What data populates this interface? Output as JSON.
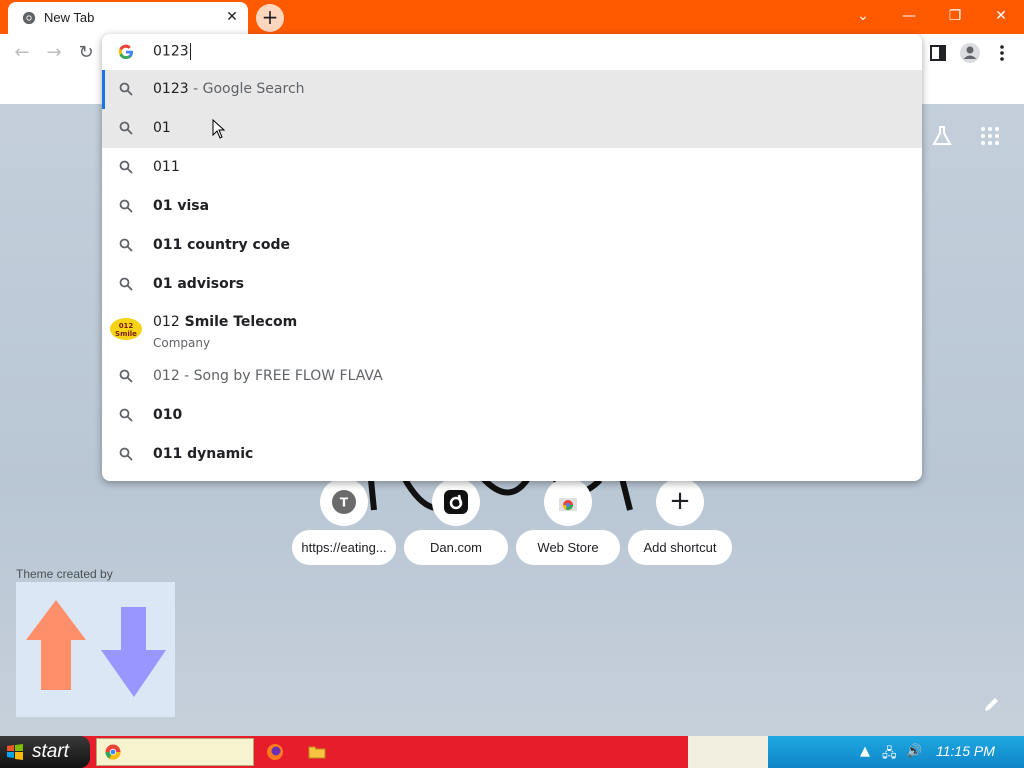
{
  "browser": {
    "tab": {
      "title": "New Tab",
      "close_icon": "close-icon"
    },
    "window_controls": [
      "chevron-down-icon",
      "minimize-icon",
      "restore-icon",
      "close-icon"
    ],
    "accent_color": "#ff5a00"
  },
  "omnibox": {
    "value": "0123",
    "suggestions": [
      {
        "main": "0123",
        "suffix": " - Google Search",
        "icon": "search-icon"
      },
      {
        "main": "01",
        "suffix": "",
        "icon": "search-icon"
      },
      {
        "main": "011",
        "suffix": "",
        "icon": "search-icon"
      },
      {
        "main": "01 visa",
        "suffix": "",
        "icon": "search-icon"
      },
      {
        "main": "011 country code",
        "suffix": "",
        "icon": "search-icon"
      },
      {
        "main": "01 advisors",
        "suffix": "",
        "icon": "search-icon"
      },
      {
        "main": "012 - Song by FREE FLOW FLAVA",
        "suffix": "",
        "icon": "search-icon"
      },
      {
        "main": "010",
        "suffix": "",
        "icon": "search-icon"
      },
      {
        "main": "011 dynamic",
        "suffix": "",
        "icon": "search-icon"
      }
    ],
    "entity": {
      "title_prefix": "012",
      "title_bold": " Smile Telecom",
      "subtitle": "Company",
      "logo_text": "012 Smile"
    }
  },
  "ntp": {
    "shortcuts": [
      {
        "label": "https://eating...",
        "icon": "T"
      },
      {
        "label": "Dan.com",
        "icon": "dan-icon"
      },
      {
        "label": "Web Store",
        "icon": "webstore-icon"
      },
      {
        "label": "Add shortcut",
        "icon": "+"
      }
    ],
    "theme_credit": "Theme created by"
  },
  "taskbar": {
    "start_label": "start",
    "clock": "11:15 PM"
  }
}
